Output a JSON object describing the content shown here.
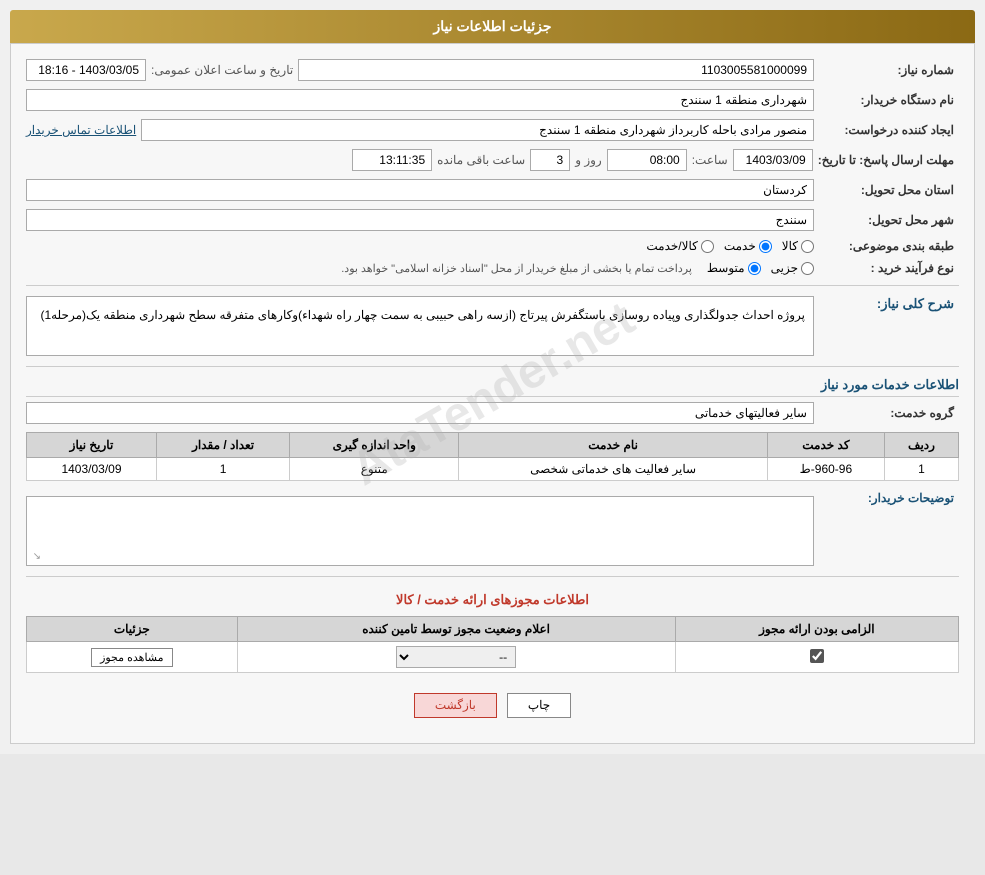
{
  "page": {
    "title": "جزئیات اطلاعات نیاز"
  },
  "header": {
    "need_number_label": "شماره نیاز:",
    "need_number_value": "1103005581000099",
    "announce_date_label": "تاریخ و ساعت اعلان عمومی:",
    "announce_date_value": "1403/03/05 - 18:16",
    "buyer_org_label": "نام دستگاه خریدار:",
    "buyer_org_value": "شهرداری منطقه 1 سنندج",
    "creator_label": "ایجاد کننده درخواست:",
    "creator_value": "منصور مرادی باحله کاربرداز شهرداری منطقه 1 سنندج",
    "contact_link": "اطلاعات تماس خریدار",
    "response_date_label": "مهلت ارسال پاسخ: تا تاریخ:",
    "response_date_value": "1403/03/09",
    "response_time_label": "ساعت:",
    "response_time_value": "08:00",
    "response_days_label": "روز و",
    "response_days_value": "3",
    "response_remaining_label": "ساعت باقی مانده",
    "response_remaining_value": "13:11:35",
    "province_label": "استان محل تحویل:",
    "province_value": "کردستان",
    "city_label": "شهر محل تحویل:",
    "city_value": "سنندج",
    "category_label": "طبقه بندی موضوعی:",
    "category_options": [
      "کالا",
      "خدمت",
      "کالا/خدمت"
    ],
    "category_selected": "خدمت",
    "purchase_type_label": "نوع فرآیند خرید :",
    "purchase_type_options": [
      "جزیی",
      "متوسط"
    ],
    "purchase_type_note": "پرداخت تمام یا بخشی از مبلغ خریدار از محل \"اسناد خزانه اسلامی\" خواهد بود."
  },
  "description": {
    "section_title": "شرح کلی نیاز:",
    "text": "پروژه احداث جدولگذاری وپیاده روسازی باستگفرش پیرتاج (ازسه راهی حبیبی به سمت چهار راه شهداء)وکارهای متفرقه سطح شهرداری منطقه یک(مرحله1)"
  },
  "services": {
    "section_title": "اطلاعات خدمات مورد نیاز",
    "service_group_label": "گروه خدمت:",
    "service_group_value": "سایر فعالیتهای خدماتی",
    "table_headers": [
      "ردیف",
      "کد خدمت",
      "نام خدمت",
      "واحد اندازه گیری",
      "تعداد / مقدار",
      "تاریخ نیاز"
    ],
    "table_rows": [
      {
        "row": "1",
        "code": "960-96-ط",
        "name": "سایر فعالیت های خدماتی شخصی",
        "unit": "متنوع",
        "quantity": "1",
        "date": "1403/03/09"
      }
    ],
    "buyer_notes_label": "توضیحات خریدار:",
    "buyer_notes_value": ""
  },
  "permissions": {
    "section_title": "اطلاعات مجوزهای ارائه خدمت / کالا",
    "table_headers": [
      "الزامی بودن ارائه مجوز",
      "اعلام وضعیت مجوز توسط تامین کننده",
      "جزئیات"
    ],
    "table_rows": [
      {
        "required": true,
        "status": "--",
        "details_label": "مشاهده مجوز"
      }
    ]
  },
  "actions": {
    "print_label": "چاپ",
    "back_label": "بازگشت"
  }
}
